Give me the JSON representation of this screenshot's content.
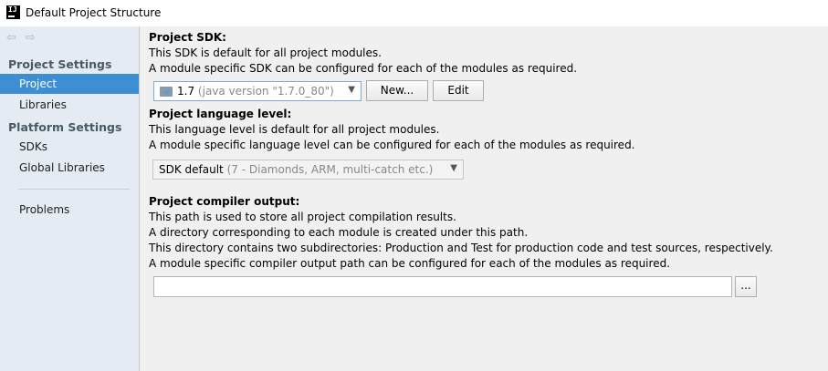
{
  "window": {
    "title": "Default Project Structure",
    "icon": "intellij-icon"
  },
  "sidebar": {
    "nav_back": "⇦",
    "nav_forward": "⇨",
    "project_settings_label": "Project Settings",
    "platform_settings_label": "Platform Settings",
    "items": [
      {
        "label": "Project"
      },
      {
        "label": "Libraries"
      },
      {
        "label": "SDKs"
      },
      {
        "label": "Global Libraries"
      },
      {
        "label": "Problems"
      }
    ],
    "selected_color": "#3d8ed3"
  },
  "main": {
    "sdk": {
      "heading": "Project SDK:",
      "line1": "This SDK is default for all project modules.",
      "line2": "A module specific SDK can be configured for each of the modules as required.",
      "selected_version": "1.7",
      "selected_detail": "(java version \"1.7.0_80\")",
      "new_button": "New...",
      "edit_button": "Edit"
    },
    "language": {
      "heading": "Project language level:",
      "line1": "This language level is default for all project modules.",
      "line2": "A module specific language level can be configured for each of the modules as required.",
      "selected_value": "SDK default",
      "selected_detail": "(7 - Diamonds, ARM, multi-catch etc.)"
    },
    "compiler": {
      "heading": "Project compiler output:",
      "line1": "This path is used to store all project compilation results.",
      "line2": "A directory corresponding to each module is created under this path.",
      "line3": "This directory contains two subdirectories: Production and Test for production code and test sources, respectively.",
      "line4": "A module specific compiler output path can be configured for each of the modules as required.",
      "path_value": "",
      "browse_button": "..."
    }
  }
}
